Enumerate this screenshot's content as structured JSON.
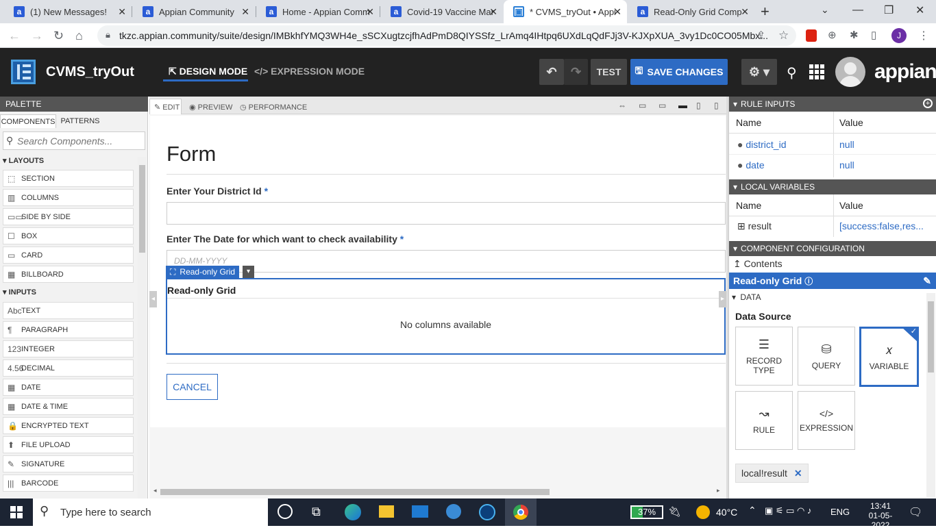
{
  "browser": {
    "tabs": [
      {
        "title": "(1) New Messages!"
      },
      {
        "title": "Appian Community"
      },
      {
        "title": "Home - Appian Comm"
      },
      {
        "title": "Covid-19 Vaccine Mar"
      },
      {
        "title": "* CVMS_tryOut • Appi"
      },
      {
        "title": "Read-Only Grid Comp"
      }
    ],
    "new_tab": "+",
    "url": "tkzc.appian.community/suite/design/IMBkhfYMQ3WH4e_sSCXugtzcjfhAdPmD8QIYSSfz_LrAmq4IHtpq6UXdLqQdFJj3V-KJXpXUA_3vy1Dc0CO05Mbx...",
    "profile_initial": "J"
  },
  "header": {
    "app_name": "CVMS_tryOut",
    "design_mode": "DESIGN MODE",
    "expression_mode": "EXPRESSION MODE",
    "test_label": "TEST",
    "save_label": "SAVE CHANGES",
    "brand": "appian"
  },
  "palette": {
    "title": "PALETTE",
    "tabs": [
      "COMPONENTS",
      "PATTERNS"
    ],
    "search_placeholder": "Search Components...",
    "layouts_title": "LAYOUTS",
    "layouts": [
      {
        "icon": "⬚",
        "label": "SECTION"
      },
      {
        "icon": "▥",
        "label": "COLUMNS"
      },
      {
        "icon": "▭▭",
        "label": "SIDE BY SIDE"
      },
      {
        "icon": "☐",
        "label": "BOX"
      },
      {
        "icon": "▭",
        "label": "CARD"
      },
      {
        "icon": "▦",
        "label": "BILLBOARD"
      }
    ],
    "inputs_title": "INPUTS",
    "inputs": [
      {
        "icon": "Abc",
        "label": "TEXT"
      },
      {
        "icon": "¶",
        "label": "PARAGRAPH"
      },
      {
        "icon": "123",
        "label": "INTEGER"
      },
      {
        "icon": "4.56",
        "label": "DECIMAL"
      },
      {
        "icon": "▦",
        "label": "DATE"
      },
      {
        "icon": "▦",
        "label": "DATE & TIME"
      },
      {
        "icon": "🔒",
        "label": "ENCRYPTED TEXT"
      },
      {
        "icon": "⬆",
        "label": "FILE UPLOAD"
      },
      {
        "icon": "✎",
        "label": "SIGNATURE"
      },
      {
        "icon": "|||",
        "label": "BARCODE"
      }
    ]
  },
  "editor": {
    "tabs": [
      "EDIT",
      "PREVIEW",
      "PERFORMANCE"
    ],
    "form_title": "Form",
    "field1_label": "Enter Your District Id",
    "field2_label": "Enter The Date for which want to check availability",
    "required_mark": "*",
    "date_placeholder": "DD-MM-YYYY",
    "grid_tag": "Read-only Grid",
    "grid_label": "Read-only Grid",
    "grid_empty": "No columns available",
    "cancel_label": "CANCEL"
  },
  "rule_inputs": {
    "title": "RULE INPUTS",
    "col_name": "Name",
    "col_value": "Value",
    "rows": [
      {
        "name": "district_id",
        "value": "null"
      },
      {
        "name": "date",
        "value": "null"
      }
    ]
  },
  "local_variables": {
    "title": "LOCAL VARIABLES",
    "col_name": "Name",
    "col_value": "Value",
    "rows": [
      {
        "name": "result",
        "value": "[success:false,res..."
      }
    ]
  },
  "component_config": {
    "title": "COMPONENT CONFIGURATION",
    "contents": "Contents",
    "selected": "Read-only Grid",
    "data_section": "DATA",
    "data_source": "Data Source",
    "sources": [
      "RECORD TYPE",
      "QUERY",
      "VARIABLE",
      "RULE",
      "EXPRESSION"
    ],
    "selected_source": "VARIABLE",
    "variable_chip": "local!result"
  },
  "taskbar": {
    "search_placeholder": "Type here to search",
    "battery": "37%",
    "temperature": "40°C",
    "language": "ENG",
    "time": "13:41",
    "date": "01-05-2022"
  },
  "colors": {
    "appian_blue": "#2d6bc4",
    "header_dark": "#222222",
    "taskbar": "#1c2433"
  }
}
